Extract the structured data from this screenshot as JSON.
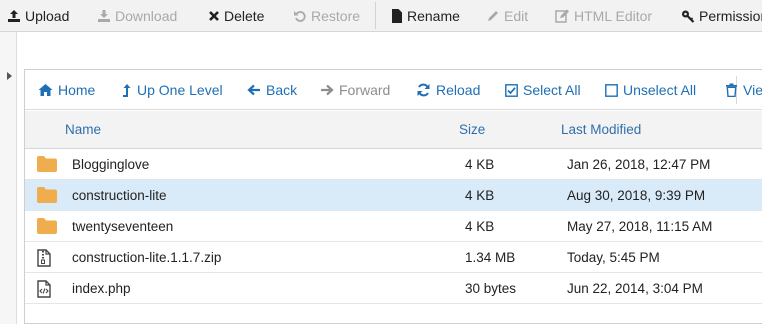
{
  "toolbar": {
    "upload": "Upload",
    "download": "Download",
    "delete": "Delete",
    "restore": "Restore",
    "rename": "Rename",
    "edit": "Edit",
    "html_editor": "HTML Editor",
    "permissions": "Permissions"
  },
  "nav": {
    "home": "Home",
    "up_one_level": "Up One Level",
    "back": "Back",
    "forward": "Forward",
    "reload": "Reload",
    "select_all": "Select All",
    "unselect_all": "Unselect All",
    "view": "View"
  },
  "table": {
    "headers": {
      "name": "Name",
      "size": "Size",
      "last_modified": "Last Modified"
    },
    "rows": [
      {
        "type": "folder-icon",
        "name": "Blogginglove",
        "size": "4 KB",
        "modified": "Jan 26, 2018, 12:47 PM",
        "selected": false
      },
      {
        "type": "folder-icon",
        "name": "construction-lite",
        "size": "4 KB",
        "modified": "Aug 30, 2018, 9:39 PM",
        "selected": true
      },
      {
        "type": "folder-icon",
        "name": "twentyseventeen",
        "size": "4 KB",
        "modified": "May 27, 2018, 11:15 AM",
        "selected": false
      },
      {
        "type": "zip-file-icon",
        "name": "construction-lite.1.1.7.zip",
        "size": "1.34 MB",
        "modified": "Today, 5:45 PM",
        "selected": false
      },
      {
        "type": "code-file-icon",
        "name": "index.php",
        "size": "30 bytes",
        "modified": "Jun 22, 2014, 3:04 PM",
        "selected": false
      }
    ]
  },
  "colors": {
    "link": "#1f6fb6",
    "header_text": "#2f6fad",
    "folder": "#f0ad4e",
    "selected_row": "#d9ebf9",
    "disabled": "#a9a9a9"
  }
}
